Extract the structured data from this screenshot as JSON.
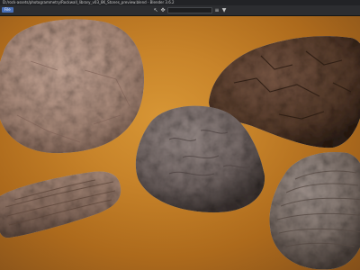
{
  "window": {
    "title": "D:/rock-assets/photogrammetry/Rockwall_library_v03_8K_Stones_preview.blend - Blender 3.6.2"
  },
  "toolbar": {
    "menu_label": "File",
    "icons": [
      "cursor-icon",
      "move-icon",
      "timeline-field",
      "filter-icon",
      "funnel-icon"
    ]
  },
  "viewport": {
    "background_colors": [
      "#d79635",
      "#c8842a",
      "#ad6a1c",
      "#84501a"
    ],
    "objects": [
      {
        "name": "rounded-boulder",
        "color": "#b89888"
      },
      {
        "name": "dark-cracked-slab",
        "color": "#5a3f2e"
      },
      {
        "name": "speckled-grey-stone",
        "color": "#7a6d6a"
      },
      {
        "name": "wood-grain-log",
        "color": "#8f7466"
      },
      {
        "name": "ribbed-stone",
        "color": "#847770"
      }
    ]
  }
}
